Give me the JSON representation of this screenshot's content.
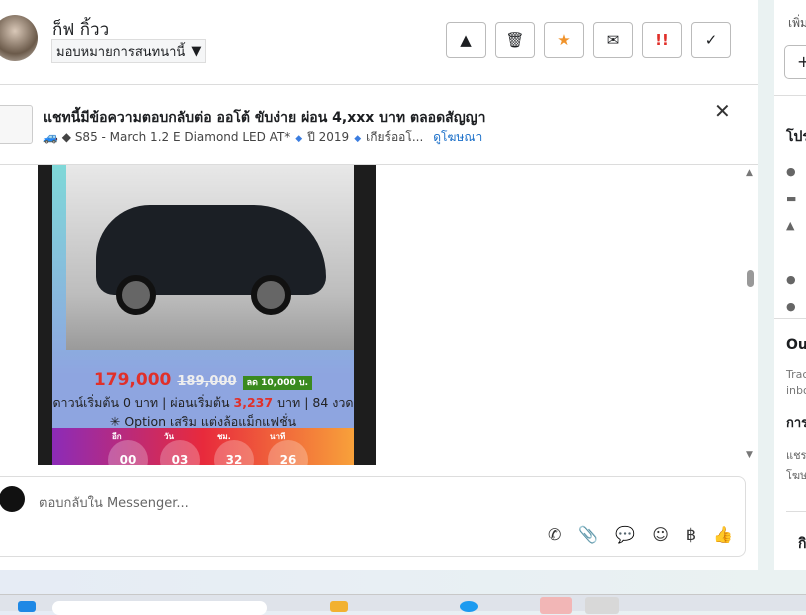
{
  "header": {
    "name": "ก็ฟ กิ้วว",
    "assign_label": "มอบหมายการสนทนานี้",
    "actions": [
      {
        "icon": "warning-icon",
        "glyph": "▲"
      },
      {
        "icon": "trash-icon",
        "glyph": "🗑"
      },
      {
        "icon": "star-icon",
        "glyph": "★"
      },
      {
        "icon": "mail-icon",
        "glyph": "✉"
      },
      {
        "icon": "urgent-icon",
        "glyph": "!!"
      },
      {
        "icon": "check-icon",
        "glyph": "✓"
      }
    ]
  },
  "ad": {
    "title": "แชทนี้มีข้อความตอบกลับต่อ ออโต้ ขับง่าย ผ่อน 4,xxx บาท ตลอดสัญญา",
    "emoji": "🚙 ◆",
    "model": "S85 - March 1.2 E Diamond LED AT*",
    "year": "ปี 2019",
    "gear": "เกียร์ออโ...",
    "view_ad": "ดูโฆษณา"
  },
  "poster": {
    "price": "179,000",
    "old_price": "189,000",
    "discount": "ลด 10,000 บ.",
    "down": "ดาวน์เริ่มต้น 0 บาท | ผ่อนเริ่มต้น",
    "installment": "3,237",
    "down_tail": "บาท | 84 งวด",
    "option": "✳ Option เสริม แต่งล้อแม็กแฟชั่น",
    "timer_labels": [
      "อีก",
      "วัน",
      "ชม.",
      "นาที"
    ],
    "timer_values": [
      "00",
      "03",
      "32",
      "26"
    ]
  },
  "composer": {
    "placeholder": "ตอบกลับใน Messenger...",
    "baht": "฿"
  },
  "right": {
    "add": "เพิ่ม",
    "profile": "โปร",
    "out": "Ou",
    "track": "Trac",
    "inbox": "inbo",
    "section": "การ",
    "share": "แชร",
    "ads": "โฆษ",
    "footer": "กิ"
  }
}
